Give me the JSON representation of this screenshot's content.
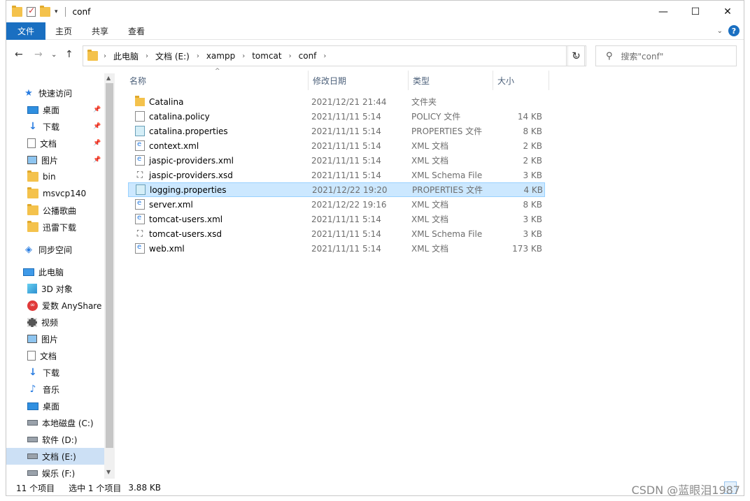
{
  "window": {
    "title": "conf",
    "controls": {
      "minimize": "—",
      "maximize": "☐",
      "close": "✕"
    }
  },
  "ribbon": {
    "tabs": [
      "文件",
      "主页",
      "共享",
      "查看"
    ],
    "help": "?"
  },
  "address": {
    "path": [
      "此电脑",
      "文档 (E:)",
      "xampp",
      "tomcat",
      "conf"
    ],
    "search_placeholder": "搜索\"conf\""
  },
  "nav": {
    "items": [
      {
        "label": "快速访问",
        "icon": "quick-access-star-icon",
        "pinned": false,
        "level": 0
      },
      {
        "label": "桌面",
        "icon": "desktop-icon",
        "pinned": true,
        "level": 1
      },
      {
        "label": "下载",
        "icon": "download-icon",
        "pinned": true,
        "level": 1
      },
      {
        "label": "文档",
        "icon": "document-icon",
        "pinned": true,
        "level": 1
      },
      {
        "label": "图片",
        "icon": "picture-icon",
        "pinned": true,
        "level": 1
      },
      {
        "label": "bin",
        "icon": "folder-icon",
        "pinned": false,
        "level": 1
      },
      {
        "label": "msvcp140",
        "icon": "folder-icon",
        "pinned": false,
        "level": 1
      },
      {
        "label": "公播歌曲",
        "icon": "folder-icon",
        "pinned": false,
        "level": 1
      },
      {
        "label": "迅雷下载",
        "icon": "folder-icon",
        "pinned": false,
        "level": 1
      },
      {
        "label": "同步空间",
        "icon": "sync-space-icon",
        "pinned": false,
        "level": 0
      },
      {
        "label": "此电脑",
        "icon": "this-pc-icon",
        "pinned": false,
        "level": 0
      },
      {
        "label": "3D 对象",
        "icon": "3d-objects-icon",
        "pinned": false,
        "level": 1
      },
      {
        "label": "爱数 AnyShare",
        "icon": "anyshare-icon",
        "pinned": false,
        "level": 1
      },
      {
        "label": "视频",
        "icon": "video-icon",
        "pinned": false,
        "level": 1
      },
      {
        "label": "图片",
        "icon": "picture-icon",
        "pinned": false,
        "level": 1
      },
      {
        "label": "文档",
        "icon": "document-icon",
        "pinned": false,
        "level": 1
      },
      {
        "label": "下载",
        "icon": "download-icon",
        "pinned": false,
        "level": 1
      },
      {
        "label": "音乐",
        "icon": "music-icon",
        "pinned": false,
        "level": 1
      },
      {
        "label": "桌面",
        "icon": "desktop-icon",
        "pinned": false,
        "level": 1
      },
      {
        "label": "本地磁盘 (C:)",
        "icon": "system-drive-icon",
        "pinned": false,
        "level": 1
      },
      {
        "label": "软件 (D:)",
        "icon": "drive-icon",
        "pinned": false,
        "level": 1
      },
      {
        "label": "文档 (E:)",
        "icon": "drive-icon",
        "pinned": false,
        "level": 1,
        "selected": true
      },
      {
        "label": "娱乐 (F:)",
        "icon": "drive-icon",
        "pinned": false,
        "level": 1
      }
    ]
  },
  "files": {
    "columns": [
      "名称",
      "修改日期",
      "类型",
      "大小"
    ],
    "rows": [
      {
        "name": "Catalina",
        "date": "2021/12/21 21:44",
        "type": "文件夹",
        "size": "",
        "icon": "folder"
      },
      {
        "name": "catalina.policy",
        "date": "2021/11/11 5:14",
        "type": "POLICY 文件",
        "size": "14 KB",
        "icon": "doc"
      },
      {
        "name": "catalina.properties",
        "date": "2021/11/11 5:14",
        "type": "PROPERTIES 文件",
        "size": "8 KB",
        "icon": "props"
      },
      {
        "name": "context.xml",
        "date": "2021/11/11 5:14",
        "type": "XML 文档",
        "size": "2 KB",
        "icon": "xml"
      },
      {
        "name": "jaspic-providers.xml",
        "date": "2021/11/11 5:14",
        "type": "XML 文档",
        "size": "2 KB",
        "icon": "xml"
      },
      {
        "name": "jaspic-providers.xsd",
        "date": "2021/11/11 5:14",
        "type": "XML Schema File",
        "size": "3 KB",
        "icon": "xsd"
      },
      {
        "name": "logging.properties",
        "date": "2021/12/22 19:20",
        "type": "PROPERTIES 文件",
        "size": "4 KB",
        "icon": "props",
        "selected": true
      },
      {
        "name": "server.xml",
        "date": "2021/12/22 19:16",
        "type": "XML 文档",
        "size": "8 KB",
        "icon": "xml"
      },
      {
        "name": "tomcat-users.xml",
        "date": "2021/11/11 5:14",
        "type": "XML 文档",
        "size": "3 KB",
        "icon": "xml"
      },
      {
        "name": "tomcat-users.xsd",
        "date": "2021/11/11 5:14",
        "type": "XML Schema File",
        "size": "3 KB",
        "icon": "xsd"
      },
      {
        "name": "web.xml",
        "date": "2021/11/11 5:14",
        "type": "XML 文档",
        "size": "173 KB",
        "icon": "xml"
      }
    ]
  },
  "status": {
    "count": "11 个项目",
    "selection": "选中 1 个项目",
    "size": "3.88 KB"
  },
  "watermark": "CSDN @蓝眼泪1987",
  "colors": {
    "accent": "#1a6fc1",
    "selection": "#cce8ff",
    "selection_border": "#99d1ff"
  }
}
